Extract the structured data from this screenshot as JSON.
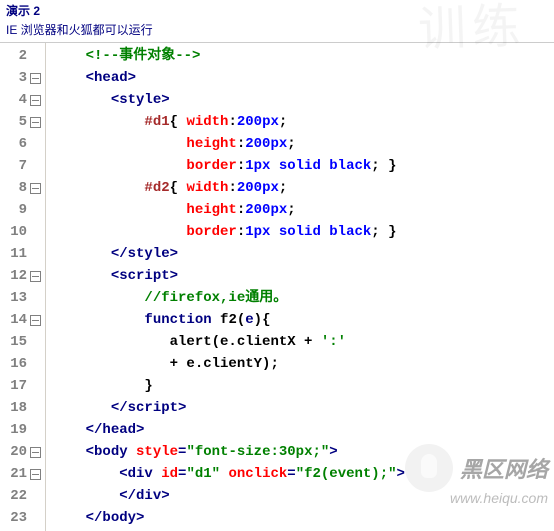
{
  "header": {
    "title": "演示 2",
    "subtitle": "IE 浏览器和火狐都可以运行"
  },
  "gutter": {
    "start": 2,
    "end": 23,
    "fold_lines": [
      3,
      4,
      5,
      8,
      12,
      14,
      20,
      21
    ]
  },
  "code": {
    "lines": [
      {
        "n": 2,
        "segs": [
          {
            "t": "    ",
            "c": "c-text"
          },
          {
            "t": "<!--事件对象-->",
            "c": "c-comment"
          }
        ]
      },
      {
        "n": 3,
        "segs": [
          {
            "t": "    ",
            "c": "c-text"
          },
          {
            "t": "<head>",
            "c": "c-tag"
          }
        ]
      },
      {
        "n": 4,
        "segs": [
          {
            "t": "       ",
            "c": "c-text"
          },
          {
            "t": "<style>",
            "c": "c-tag"
          }
        ]
      },
      {
        "n": 5,
        "segs": [
          {
            "t": "           ",
            "c": "c-text"
          },
          {
            "t": "#d1",
            "c": "c-css-sel"
          },
          {
            "t": "{ ",
            "c": "c-css-brace"
          },
          {
            "t": "width",
            "c": "c-css-prop"
          },
          {
            "t": ":",
            "c": "c-text"
          },
          {
            "t": "200px",
            "c": "c-css-val"
          },
          {
            "t": ";",
            "c": "c-text"
          }
        ]
      },
      {
        "n": 6,
        "segs": [
          {
            "t": "                ",
            "c": "c-text"
          },
          {
            "t": "height",
            "c": "c-css-prop"
          },
          {
            "t": ":",
            "c": "c-text"
          },
          {
            "t": "200px",
            "c": "c-css-val"
          },
          {
            "t": ";",
            "c": "c-text"
          }
        ]
      },
      {
        "n": 7,
        "segs": [
          {
            "t": "                ",
            "c": "c-text"
          },
          {
            "t": "border",
            "c": "c-css-prop"
          },
          {
            "t": ":",
            "c": "c-text"
          },
          {
            "t": "1px solid black",
            "c": "c-css-val"
          },
          {
            "t": "; }",
            "c": "c-css-brace"
          }
        ]
      },
      {
        "n": 8,
        "segs": [
          {
            "t": "           ",
            "c": "c-text"
          },
          {
            "t": "#d2",
            "c": "c-css-sel"
          },
          {
            "t": "{ ",
            "c": "c-css-brace"
          },
          {
            "t": "width",
            "c": "c-css-prop"
          },
          {
            "t": ":",
            "c": "c-text"
          },
          {
            "t": "200px",
            "c": "c-css-val"
          },
          {
            "t": ";",
            "c": "c-text"
          }
        ]
      },
      {
        "n": 9,
        "segs": [
          {
            "t": "                ",
            "c": "c-text"
          },
          {
            "t": "height",
            "c": "c-css-prop"
          },
          {
            "t": ":",
            "c": "c-text"
          },
          {
            "t": "200px",
            "c": "c-css-val"
          },
          {
            "t": ";",
            "c": "c-text"
          }
        ]
      },
      {
        "n": 10,
        "segs": [
          {
            "t": "                ",
            "c": "c-text"
          },
          {
            "t": "border",
            "c": "c-css-prop"
          },
          {
            "t": ":",
            "c": "c-text"
          },
          {
            "t": "1px solid black",
            "c": "c-css-val"
          },
          {
            "t": "; }",
            "c": "c-css-brace"
          }
        ]
      },
      {
        "n": 11,
        "segs": [
          {
            "t": "       ",
            "c": "c-text"
          },
          {
            "t": "</style>",
            "c": "c-tag"
          }
        ]
      },
      {
        "n": 12,
        "segs": [
          {
            "t": "       ",
            "c": "c-text"
          },
          {
            "t": "<script>",
            "c": "c-tag"
          }
        ]
      },
      {
        "n": 13,
        "segs": [
          {
            "t": "           ",
            "c": "c-text"
          },
          {
            "t": "//firefox,ie通用。",
            "c": "c-jscom"
          }
        ]
      },
      {
        "n": 14,
        "segs": [
          {
            "t": "           ",
            "c": "c-text"
          },
          {
            "t": "function",
            "c": "c-keyword"
          },
          {
            "t": " ",
            "c": "c-text"
          },
          {
            "t": "f2",
            "c": "c-fnname"
          },
          {
            "t": "(",
            "c": "c-op"
          },
          {
            "t": "e",
            "c": "c-keyword"
          },
          {
            "t": "){",
            "c": "c-op"
          }
        ]
      },
      {
        "n": 15,
        "segs": [
          {
            "t": "              ",
            "c": "c-text"
          },
          {
            "t": "alert(e.clientX + ",
            "c": "c-func"
          },
          {
            "t": "':'",
            "c": "c-string"
          }
        ]
      },
      {
        "n": 16,
        "segs": [
          {
            "t": "              ",
            "c": "c-text"
          },
          {
            "t": "+ e.clientY);",
            "c": "c-func"
          }
        ]
      },
      {
        "n": 17,
        "segs": [
          {
            "t": "           ",
            "c": "c-text"
          },
          {
            "t": "}",
            "c": "c-op"
          }
        ]
      },
      {
        "n": 18,
        "segs": [
          {
            "t": "       ",
            "c": "c-text"
          },
          {
            "t": "</script>",
            "c": "c-tag"
          }
        ]
      },
      {
        "n": 19,
        "segs": [
          {
            "t": "    ",
            "c": "c-text"
          },
          {
            "t": "</head>",
            "c": "c-tag"
          }
        ]
      },
      {
        "n": 20,
        "segs": [
          {
            "t": "    ",
            "c": "c-text"
          },
          {
            "t": "<body ",
            "c": "c-tag"
          },
          {
            "t": "style",
            "c": "c-attr"
          },
          {
            "t": "=",
            "c": "c-tag"
          },
          {
            "t": "\"font-size:30px;\"",
            "c": "c-string"
          },
          {
            "t": ">",
            "c": "c-tag"
          }
        ]
      },
      {
        "n": 21,
        "segs": [
          {
            "t": "        ",
            "c": "c-text"
          },
          {
            "t": "<div ",
            "c": "c-tag"
          },
          {
            "t": "id",
            "c": "c-attr"
          },
          {
            "t": "=",
            "c": "c-tag"
          },
          {
            "t": "\"d1\"",
            "c": "c-string"
          },
          {
            "t": " ",
            "c": "c-text"
          },
          {
            "t": "onclick",
            "c": "c-attr"
          },
          {
            "t": "=",
            "c": "c-tag"
          },
          {
            "t": "\"f2(event);\"",
            "c": "c-string"
          },
          {
            "t": ">",
            "c": "c-tag"
          }
        ]
      },
      {
        "n": 22,
        "segs": [
          {
            "t": "        ",
            "c": "c-text"
          },
          {
            "t": "</div>",
            "c": "c-tag"
          }
        ]
      },
      {
        "n": 23,
        "segs": [
          {
            "t": "    ",
            "c": "c-text"
          },
          {
            "t": "</body>",
            "c": "c-tag"
          }
        ]
      }
    ]
  },
  "watermark": {
    "title": "黑区网络",
    "url": "www.heiqu.com",
    "bg_hint": "训练"
  }
}
